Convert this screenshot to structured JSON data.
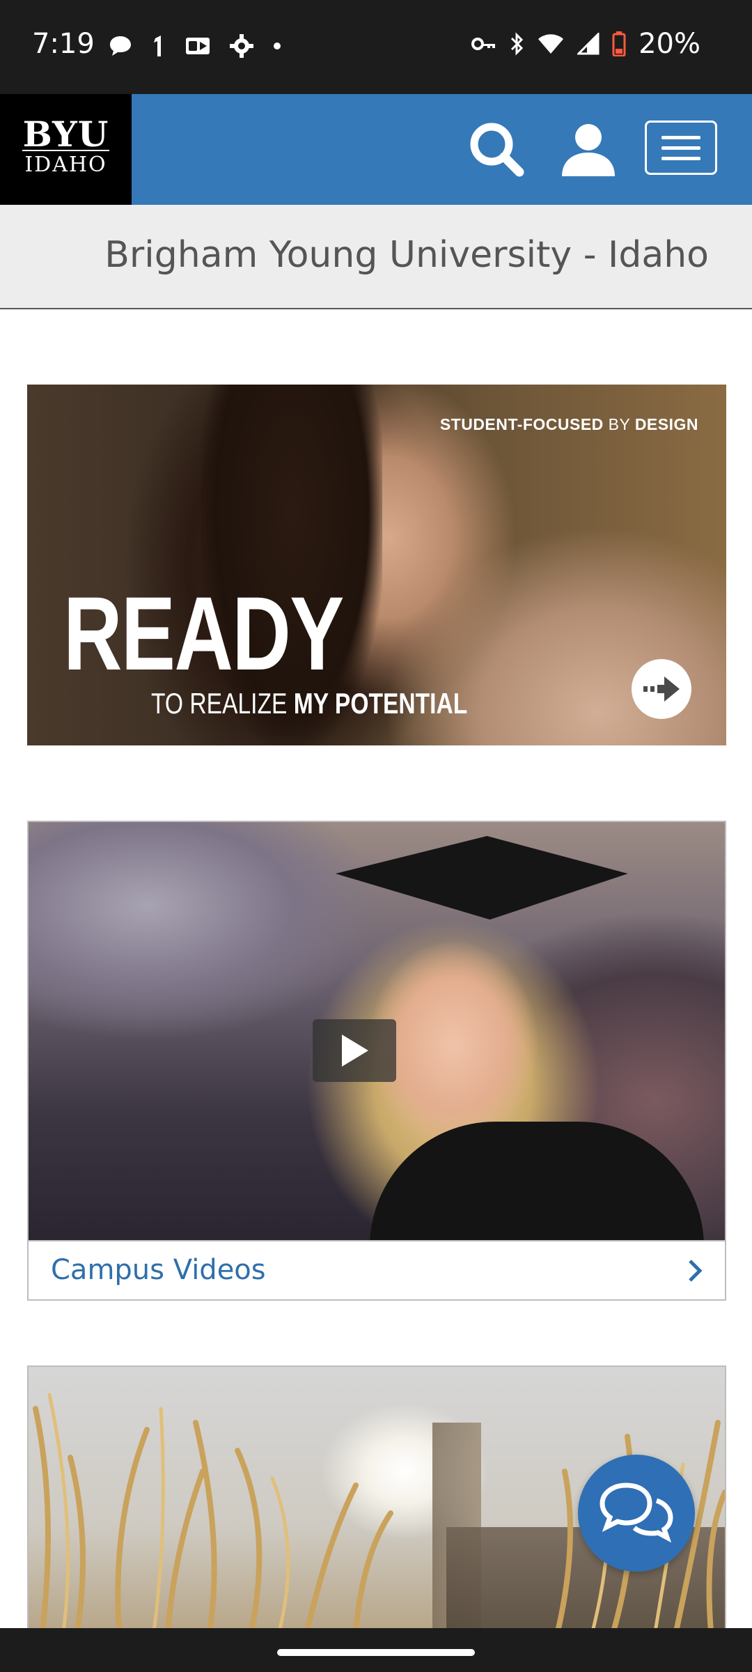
{
  "status_bar": {
    "time": "7:19",
    "battery": "20%",
    "left_icons": [
      "chat-bubble-icon",
      "signal-1-icon",
      "outlook-icon",
      "settings-icon",
      "dot-icon"
    ],
    "right_icons": [
      "vpn-key-icon",
      "bluetooth-icon",
      "wifi-icon",
      "cell-signal-icon",
      "battery-icon"
    ]
  },
  "header": {
    "logo_top": "BYU",
    "logo_bottom": "IDAHO",
    "brand_color": "#3579b8"
  },
  "title_bar": {
    "title": "Brigham Young University - Idaho"
  },
  "banner": {
    "tagline_bold": "STUDENT-FOCUSED",
    "tagline_mid": " BY ",
    "tagline_end": "DESIGN",
    "headline": "READY",
    "subline_light": "TO REALIZE ",
    "subline_bold": "MY POTENTIAL"
  },
  "video_card": {
    "label": "Campus Videos",
    "link_color": "#2f6fab"
  },
  "chat": {
    "icon": "chat-bubbles-icon",
    "color": "#2f6fb5"
  }
}
